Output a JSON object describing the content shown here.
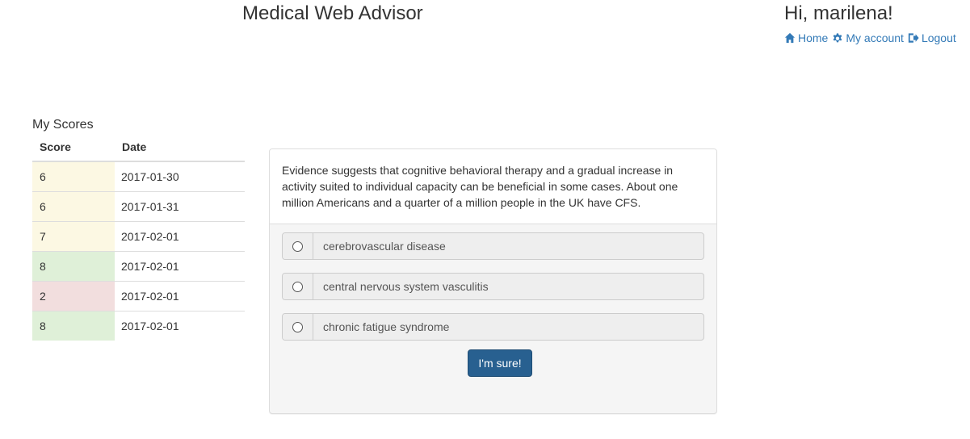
{
  "header": {
    "app_title": "Medical Web Advisor",
    "greeting": "Hi, marilena!",
    "nav": [
      {
        "label": "Home",
        "icon": "home-icon"
      },
      {
        "label": "My account",
        "icon": "gear-icon"
      },
      {
        "label": "Logout",
        "icon": "logout-icon"
      }
    ]
  },
  "scores": {
    "title": "My Scores",
    "columns": [
      "Score",
      "Date"
    ],
    "rows": [
      {
        "score": "6",
        "date": "2017-01-30",
        "status": "warning"
      },
      {
        "score": "6",
        "date": "2017-01-31",
        "status": "warning"
      },
      {
        "score": "7",
        "date": "2017-02-01",
        "status": "warning"
      },
      {
        "score": "8",
        "date": "2017-02-01",
        "status": "success"
      },
      {
        "score": "2",
        "date": "2017-02-01",
        "status": "danger"
      },
      {
        "score": "8",
        "date": "2017-02-01",
        "status": "success"
      }
    ]
  },
  "question": {
    "text": "Evidence suggests that cognitive behavioral therapy and a gradual increase in activity suited to individual capacity can be beneficial in some cases. About one million Americans and a quarter of a million people in the UK have CFS.",
    "options": [
      "cerebrovascular disease",
      "central nervous system vasculitis",
      "chronic fatigue syndrome"
    ],
    "submit_label": "I'm sure!"
  },
  "colors": {
    "link": "#337ab7",
    "primary_button": "#286090",
    "warning_bg": "#fcf8e3",
    "success_bg": "#dff0d8",
    "danger_bg": "#f2dede"
  }
}
